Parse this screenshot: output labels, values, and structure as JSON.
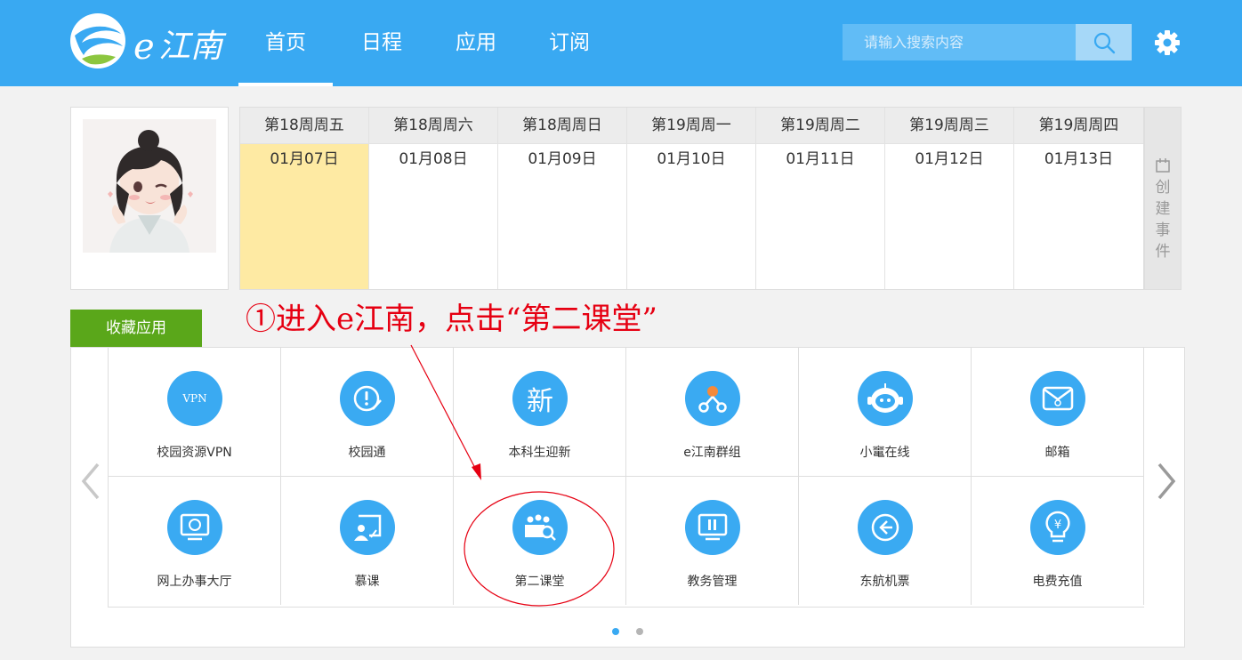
{
  "header": {
    "logo_text": "e江南",
    "nav": [
      {
        "label": "首页",
        "active": true
      },
      {
        "label": "日程",
        "active": false
      },
      {
        "label": "应用",
        "active": false
      },
      {
        "label": "订阅",
        "active": false
      }
    ],
    "search_placeholder": "请输入搜索内容",
    "icons": {
      "search": "search-icon",
      "settings": "gear-icon"
    }
  },
  "calendar": {
    "days": [
      {
        "week": "第18周周五",
        "date": "01月07日",
        "today": true
      },
      {
        "week": "第18周周六",
        "date": "01月08日",
        "today": false
      },
      {
        "week": "第18周周日",
        "date": "01月09日",
        "today": false
      },
      {
        "week": "第19周周一",
        "date": "01月10日",
        "today": false
      },
      {
        "week": "第19周周二",
        "date": "01月11日",
        "today": false
      },
      {
        "week": "第19周周三",
        "date": "01月12日",
        "today": false
      },
      {
        "week": "第19周周四",
        "date": "01月13日",
        "today": false
      }
    ],
    "create_event_label": "创建事件"
  },
  "annotation": "①进入e江南，点击“第二课堂”",
  "favorites": {
    "tab_label": "收藏应用",
    "apps": [
      {
        "label": "校园资源VPN",
        "icon": "vpn-icon",
        "glyph": "VPN"
      },
      {
        "label": "校园通",
        "icon": "campus-pass-icon"
      },
      {
        "label": "本科生迎新",
        "icon": "freshman-icon",
        "glyph": "新"
      },
      {
        "label": "e江南群组",
        "icon": "group-icon"
      },
      {
        "label": "小竃在线",
        "icon": "robot-icon"
      },
      {
        "label": "邮箱",
        "icon": "mail-icon"
      },
      {
        "label": "网上办事大厅",
        "icon": "online-hall-icon"
      },
      {
        "label": "慕课",
        "icon": "mooc-icon"
      },
      {
        "label": "第二课堂",
        "icon": "second-classroom-icon"
      },
      {
        "label": "教务管理",
        "icon": "academic-icon"
      },
      {
        "label": "东航机票",
        "icon": "airline-icon"
      },
      {
        "label": "电费充值",
        "icon": "electricity-icon",
        "glyph": "¥"
      }
    ],
    "page_dots": 2,
    "active_dot": 1
  },
  "colors": {
    "header_bg": "#39a9f2",
    "accent_green": "#5aa71a",
    "today_bg": "#feeaa3",
    "annotation_red": "#e60012"
  }
}
